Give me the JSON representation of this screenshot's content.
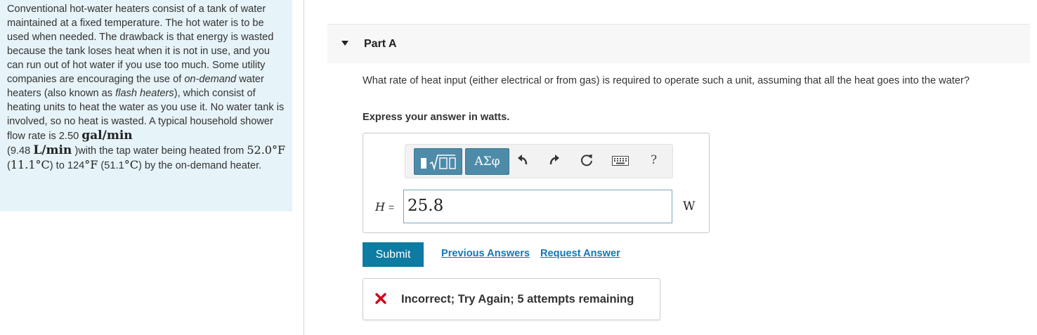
{
  "problem": {
    "t1": "Conventional hot-water heaters consist of a tank of water maintained at a fixed temperature. The hot water is to be used when needed. The drawback is that energy is wasted because the tank loses heat when it is not in use, and you can run out of hot water if you use too much. Some utility companies are encouraging the use of ",
    "em1": "on-demand",
    "t2": " water heaters (also known as ",
    "em2": "flash heaters",
    "t3": "), which consist of heating units to heat the water as you use it. No water tank is involved, so no heat is wasted. A typical household shower flow rate is 2.50 ",
    "unit1": "gal/min",
    "t4": "(9.48 ",
    "unit2": "L/min",
    "t5": " )with the tap water being heated from ",
    "temp1": "52.0°F",
    "t6": " (",
    "temp2": "11.1°C",
    "t7": ") to 124",
    "temp3": "°F",
    "t8": " (51.1",
    "temp4": "°C",
    "t9": ") by the on-demand heater."
  },
  "part": {
    "title": "Part A"
  },
  "question": "What rate of heat input (either electrical or from gas) is required to operate such a unit, assuming that all the heat goes into the water?",
  "instruction": "Express your answer in watts.",
  "toolbar": {
    "symbols_label": "ΑΣφ",
    "help_label": "?",
    "icons": [
      "template-icon",
      "undo-icon",
      "redo-icon",
      "reset-icon",
      "keyboard-icon",
      "help-icon"
    ]
  },
  "answer": {
    "variable": "H",
    "equals": "=",
    "value": "25.8",
    "unit": "W"
  },
  "actions": {
    "submit": "Submit",
    "previous_answers": "Previous Answers",
    "request_answer": "Request Answer"
  },
  "feedback": {
    "message": "Incorrect; Try Again; 5 attempts remaining",
    "status_color": "#d0021b"
  },
  "colors": {
    "accent": "#0d7ba2",
    "link": "#1477b5",
    "panel_bg": "#e6f3f8"
  }
}
